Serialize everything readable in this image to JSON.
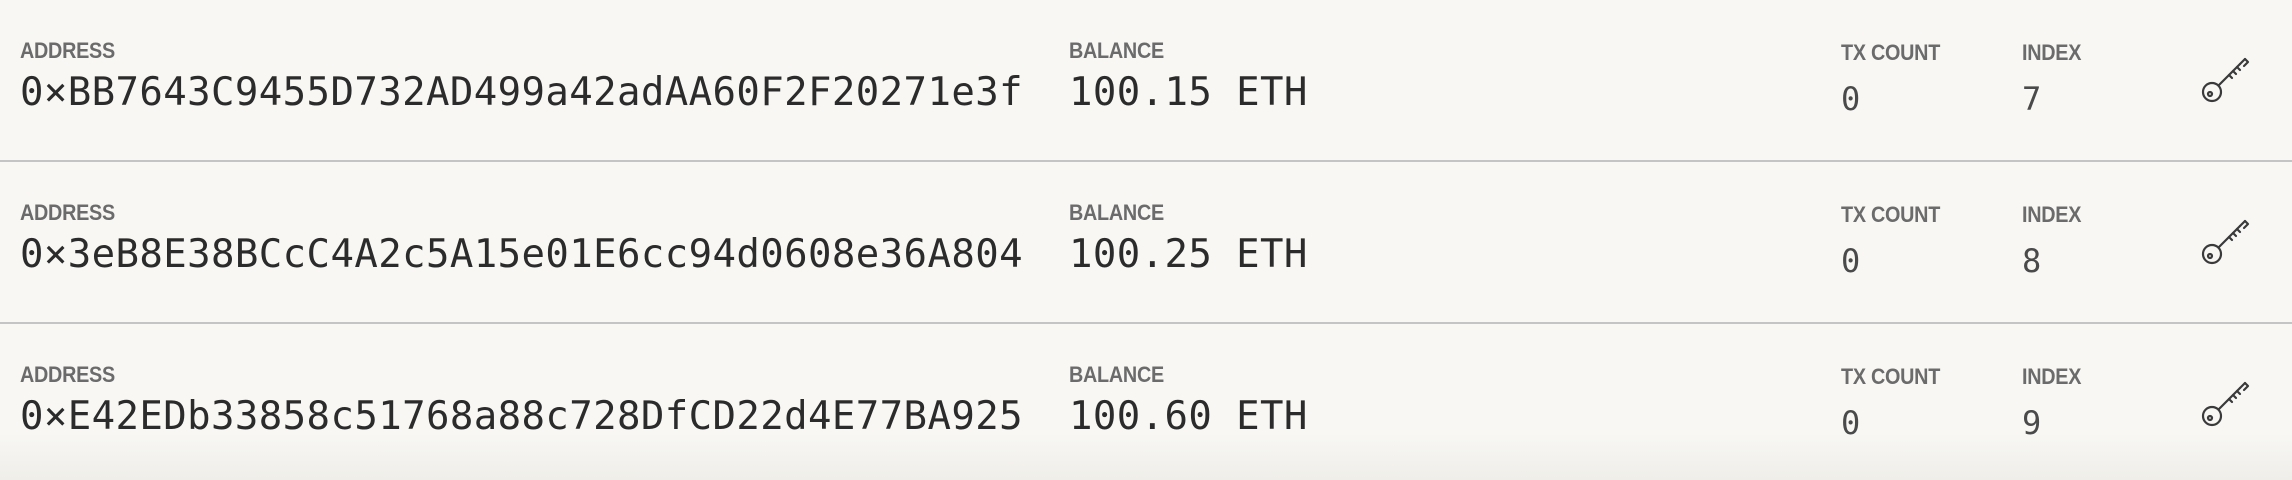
{
  "labels": {
    "address": "ADDRESS",
    "balance": "BALANCE",
    "tx_count": "TX COUNT",
    "index": "INDEX"
  },
  "accounts": [
    {
      "address": "0×BB7643C9455D732AD499a42adAA60F2F20271e3f",
      "balance": "100.15 ETH",
      "tx_count": "0",
      "index": "7",
      "action_icon": "key-icon"
    },
    {
      "address": "0×3eB8E38BCcC4A2c5A15e01E6cc94d0608e36A804",
      "balance": "100.25 ETH",
      "tx_count": "0",
      "index": "8",
      "action_icon": "key-icon"
    },
    {
      "address": "0×E42EDb33858c51768a88c728DfCD22d4E77BA925",
      "balance": "100.60 ETH",
      "tx_count": "0",
      "index": "9",
      "action_icon": "key-icon"
    }
  ]
}
